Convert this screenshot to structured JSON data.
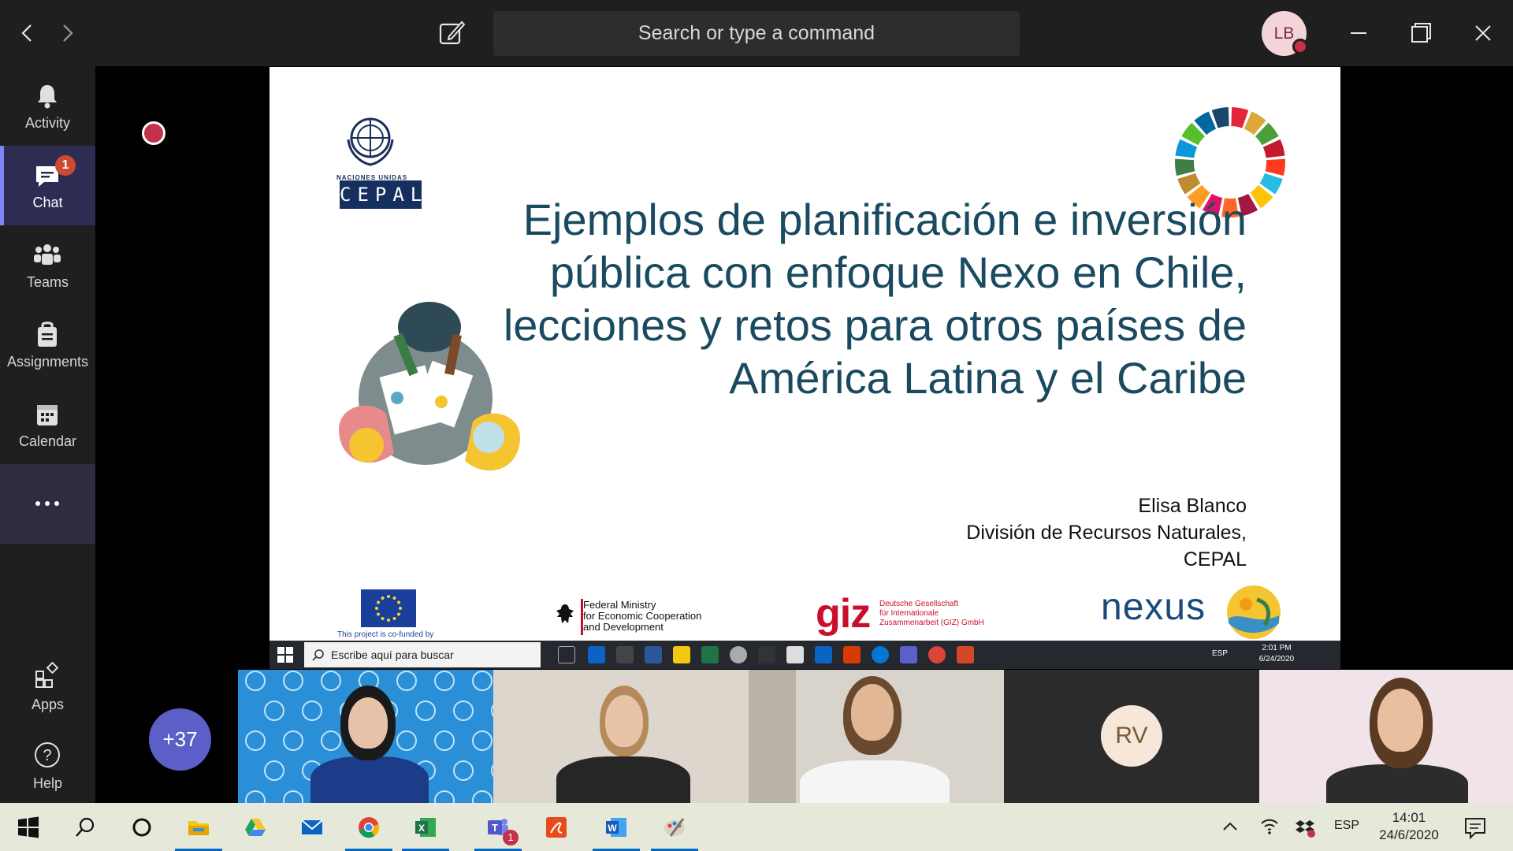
{
  "window": {
    "search_placeholder": "Search or type a command",
    "user_initials": "LB",
    "presence_color": "#c4314b"
  },
  "rail": {
    "items": [
      {
        "label": "Activity",
        "icon": "bell-icon"
      },
      {
        "label": "Chat",
        "icon": "chat-icon",
        "badge": "1",
        "active": true
      },
      {
        "label": "Teams",
        "icon": "teams-icon"
      },
      {
        "label": "Assignments",
        "icon": "assignments-icon"
      },
      {
        "label": "Calendar",
        "icon": "calendar-icon"
      },
      {
        "label": "",
        "icon": "more-icon"
      }
    ],
    "bottom": [
      {
        "label": "Apps",
        "icon": "apps-icon"
      },
      {
        "label": "Help",
        "icon": "help-icon"
      }
    ]
  },
  "slide": {
    "un_label": "NACIONES UNIDAS",
    "cepal_label": "CEPAL",
    "title": "Ejemplos de planificación e inversión pública con enfoque Nexo en Chile, lecciones y retos para otros países de América Latina y el Caribe",
    "author": [
      "Elisa Blanco",
      "División de Recursos Naturales,",
      "CEPAL"
    ],
    "eu_caption": "This project is co-funded by",
    "bmz": [
      "Federal Ministry",
      "for Economic Cooperation",
      "and Development"
    ],
    "giz": "giz",
    "giz_text": [
      "Deutsche Gesellschaft",
      "für Internationale",
      "Zusammenarbeit (GIZ) GmbH"
    ],
    "nexus": "nexus"
  },
  "remote_taskbar": {
    "search_placeholder": "Escribe aquí para buscar",
    "language": "ESP",
    "time": "2:01 PM",
    "date": "6/24/2020"
  },
  "participants": {
    "overflow": "+37",
    "rv_initials": "RV"
  },
  "taskbar": {
    "language": "ESP",
    "time": "14:01",
    "date": "24/6/2020",
    "teams_badge": "1"
  },
  "colors": {
    "accent": "#5b5fc7",
    "rail_bg": "#1f1f1f",
    "slide_title": "#1a4a60",
    "badge": "#cc4a31"
  }
}
